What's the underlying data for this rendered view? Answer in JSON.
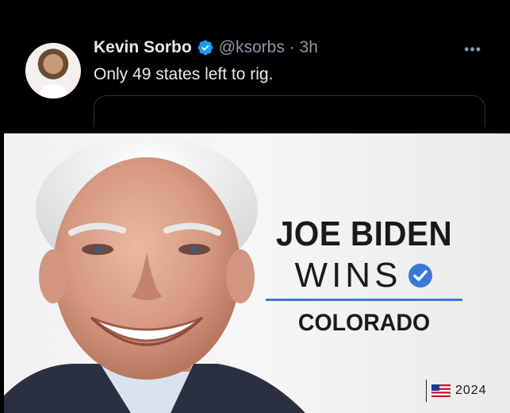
{
  "tweet": {
    "display_name": "Kevin Sorbo",
    "handle_time": "@ksorbs · 3h",
    "text": "Only 49 states left to rig.",
    "more_label": "•••"
  },
  "graphic": {
    "headline_name": "JOE BIDEN",
    "headline_verb": "WINS",
    "state": "COLORADO",
    "year": "2024"
  },
  "colors": {
    "background": "#000000",
    "verified_blue": "#1d9bf0",
    "accent_rule": "#3b77d8",
    "muted_text": "#8b98a5"
  },
  "icons": {
    "verified": "verified-badge-icon",
    "more": "more-icon",
    "check": "check-circle-icon",
    "flag": "us-flag-icon"
  }
}
